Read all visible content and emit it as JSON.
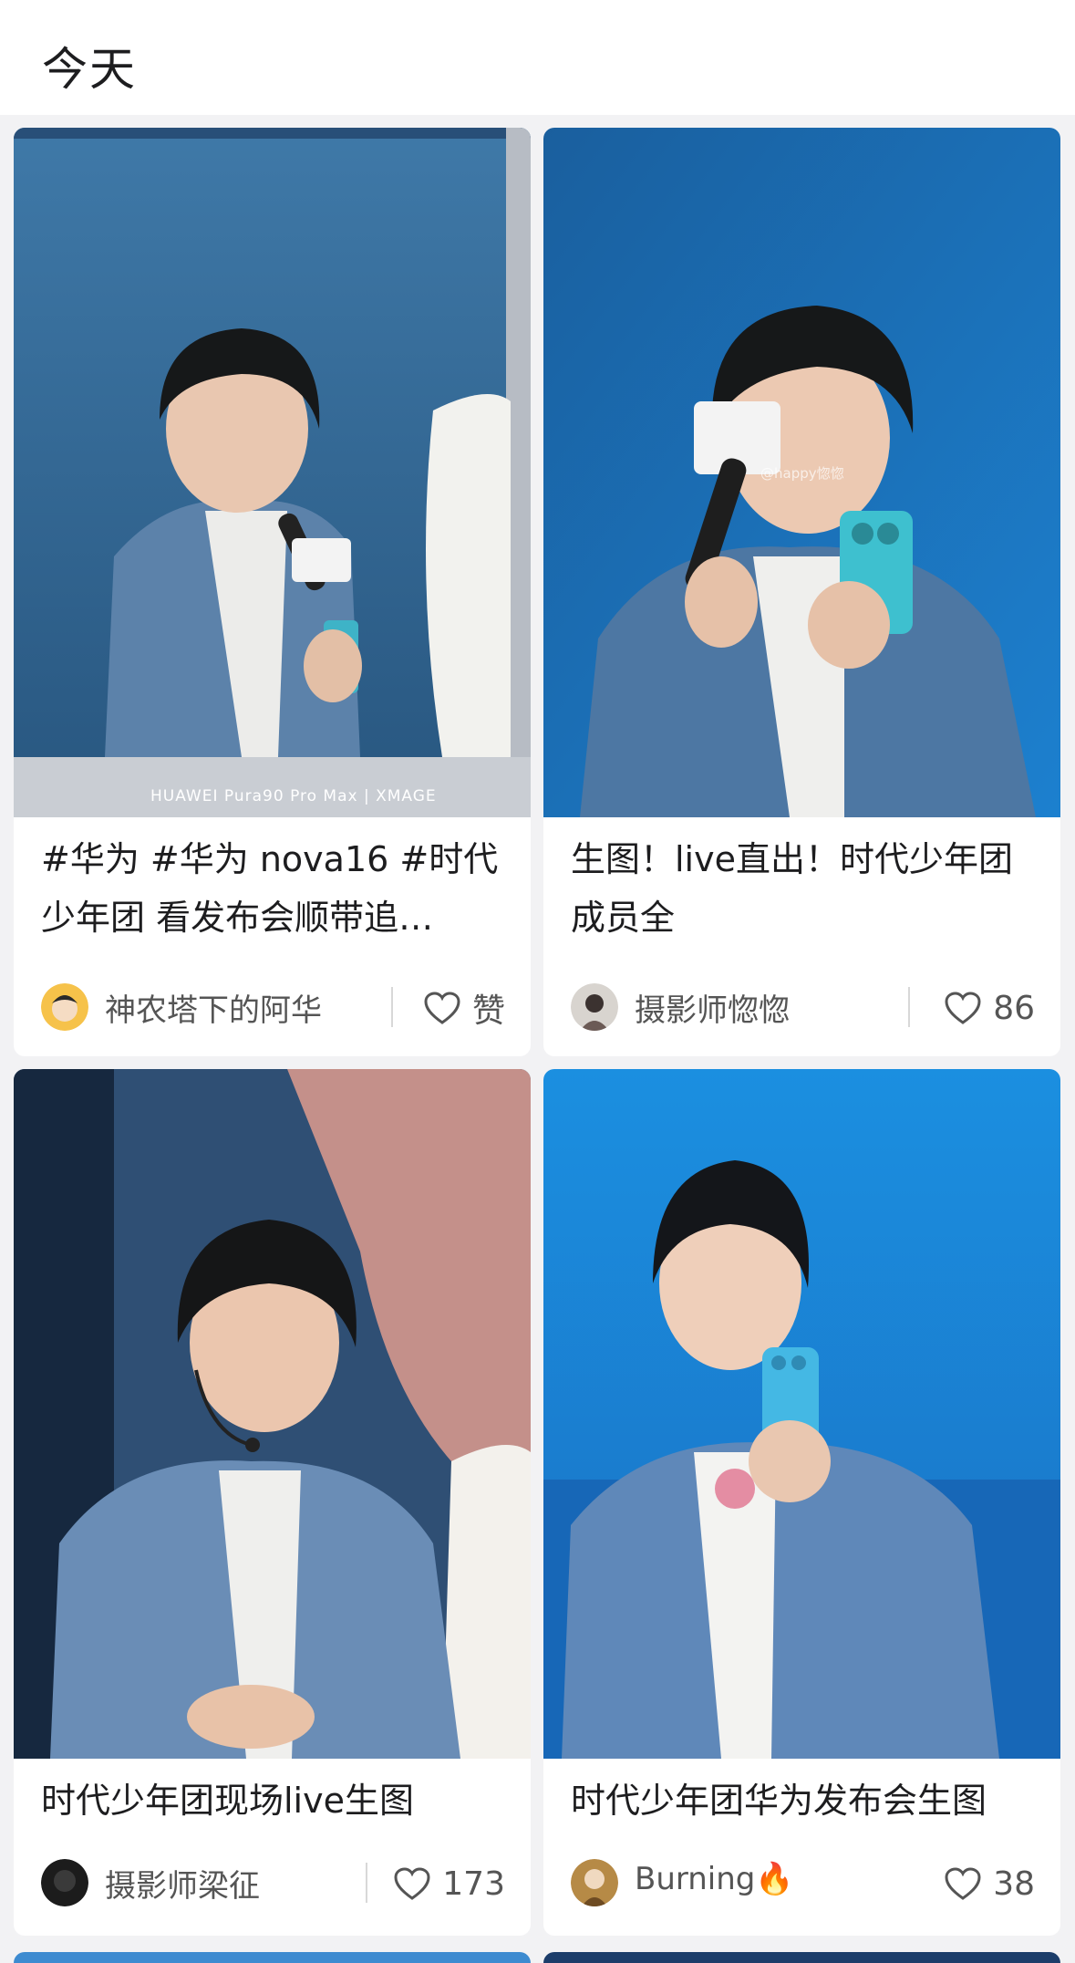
{
  "header": {
    "title": "今天"
  },
  "cards": [
    {
      "caption": "#华为 #华为 nova16 #时代少年团 看发布会顺带追…",
      "author": "神农塔下的阿华",
      "likes": "赞",
      "photo_overlay": "HUAWEI Pura90 Pro Max | XMAGE",
      "bg_color": "#3a6f9e"
    },
    {
      "caption": "生图！live直出！时代少年团成员全",
      "author": "摄影师惚惚",
      "likes": "86",
      "photo_overlay": "@happy惚惚",
      "bg_color": "#1d6fb5"
    },
    {
      "caption": "时代少年团现场live生图",
      "author": "摄影师梁征",
      "likes": "173",
      "bg_color": "#2a4d77"
    },
    {
      "caption": "时代少年团华为发布会生图",
      "author": "Burning🔥",
      "likes": "38",
      "bg_color": "#1f8bd8"
    }
  ],
  "colors": {
    "accent": "#e23b3b",
    "text": "#1d1d1f",
    "muted": "#555555"
  }
}
